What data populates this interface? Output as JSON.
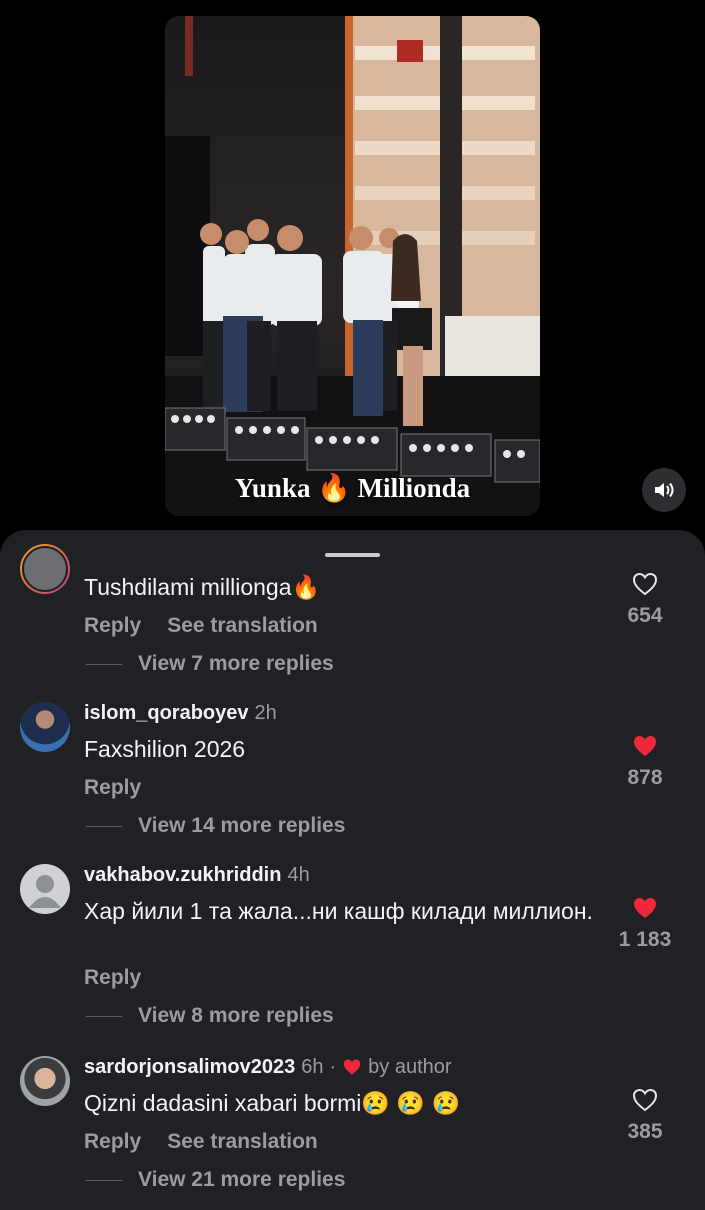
{
  "video": {
    "caption": "Yunka 🔥 Millionda",
    "mute_icon": "speaker-icon"
  },
  "comments": [
    {
      "username": "",
      "time": "",
      "text": "Tushdilami millionga🔥",
      "reply_label": "Reply",
      "translate_label": "See translation",
      "likes": "654",
      "liked": false,
      "view_replies": "View 7 more replies"
    },
    {
      "username": "islom_qoraboyev",
      "time": "2h",
      "text": "Faxshilion 2026",
      "reply_label": "Reply",
      "likes": "878",
      "liked": true,
      "view_replies": "View 14 more replies"
    },
    {
      "username": "vakhabov.zukhriddin",
      "time": "4h",
      "text": "Хар йили 1 та жала...ни кашф килади миллион.",
      "reply_label": "Reply",
      "likes": "1 183",
      "liked": true,
      "view_replies": "View 8 more replies"
    },
    {
      "username": "sardorjonsalimov2023",
      "time": "6h",
      "by_author": "by author",
      "text": "Qizni dadasini xabari bormi😢 😢 😢",
      "reply_label": "Reply",
      "translate_label": "See translation",
      "likes": "385",
      "liked": false,
      "view_replies": "View 21 more replies"
    }
  ],
  "colors": {
    "sheet_bg": "#202124",
    "liked_heart": "#f0283c",
    "muted_text": "#9a9ca1"
  }
}
